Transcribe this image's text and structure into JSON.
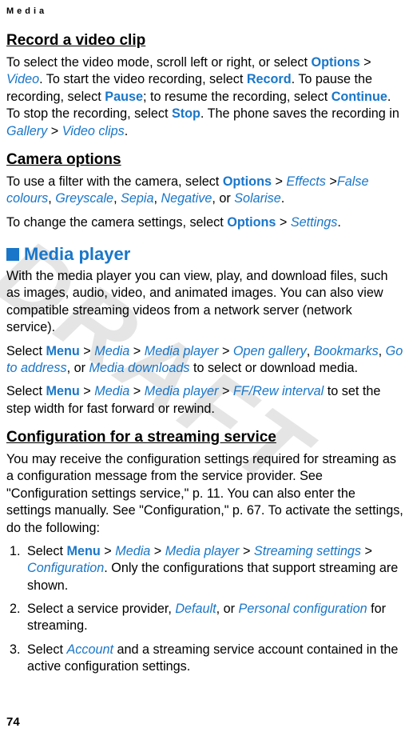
{
  "header": {
    "label": "Media"
  },
  "watermark": "DRAFT",
  "sections": {
    "record": {
      "title": "Record a video clip",
      "p1_a": "To select the video mode, scroll left or right, or select ",
      "options": "Options",
      "gt": " > ",
      "video": "Video",
      "p1_b": ". To start the video recording, select ",
      "record_lbl": "Record",
      "p1_c": ". To pause the recording, select ",
      "pause": "Pause",
      "p1_d": "; to resume the recording, select ",
      "continue": "Continue",
      "p1_e": ". To stop the recording, select ",
      "stop": "Stop",
      "p1_f": ". The phone saves the recording in ",
      "gallery": "Gallery",
      "video_clips": "Video clips",
      "period": "."
    },
    "camera": {
      "title": "Camera options",
      "p1_a": "To use a filter with the camera, select ",
      "options": "Options",
      "gt": " > ",
      "effects": "Effects",
      "gt2": " >",
      "false_colours": "False colours",
      "comma": ", ",
      "greyscale": "Greyscale",
      "sepia": "Sepia",
      "negative": "Negative",
      "or": ", or ",
      "solarise": "Solarise",
      "period": ".",
      "p2_a": "To change the camera settings, select ",
      "settings": "Settings"
    },
    "media_player": {
      "title": "Media player",
      "p1": "With the media player you can view, play, and download files, such as images, audio, video, and animated images. You can also view compatible streaming videos from a network server (network service).",
      "p2_a": "Select ",
      "menu": "Menu",
      "gt": " > ",
      "media": "Media",
      "media_player_lbl": "Media player",
      "open_gallery": "Open gallery",
      "comma": ", ",
      "bookmarks": "Bookmarks",
      "go_to_address": "Go to address",
      "or": ", or ",
      "media_downloads": "Media downloads",
      "p2_b": " to select or download media.",
      "p3_a": "Select ",
      "ff_rew": "FF/Rew interval",
      "p3_b": " to set the step width for fast forward or rewind."
    },
    "config": {
      "title": "Configuration for a streaming service",
      "p1": "You may receive the configuration settings required for streaming as a configuration message from the service provider. See \"Configuration settings service,\" p. 11. You can also enter the settings manually. See \"Configuration,\" p. 67. To activate the settings, do the following:",
      "li1_a": "Select ",
      "menu": "Menu",
      "gt": " > ",
      "media": "Media",
      "media_player_lbl": "Media player",
      "streaming_settings": "Streaming settings",
      "configuration": "Configuration",
      "li1_b": ". Only the configurations that support streaming are shown.",
      "li2_a": "Select a service provider, ",
      "default": "Default",
      "or": ", or ",
      "personal_config": "Personal configuration",
      "li2_b": " for streaming.",
      "li3_a": "Select ",
      "account": "Account",
      "li3_b": " and a streaming service account contained in the active configuration settings."
    }
  },
  "page_number": "74"
}
